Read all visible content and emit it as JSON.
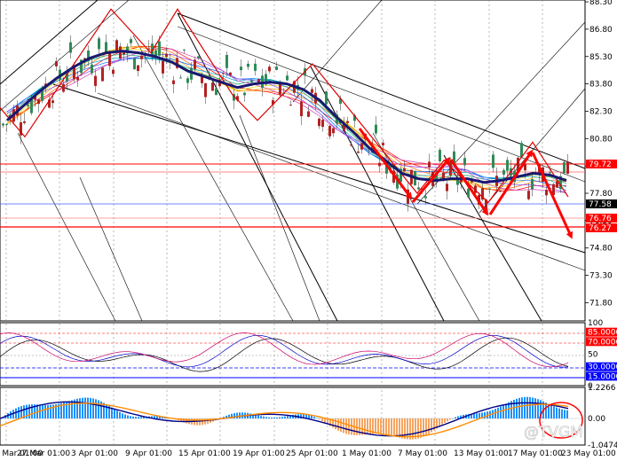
{
  "chart_data": {
    "type": "line",
    "title": "",
    "price_axis": {
      "ticks": [
        "88.30",
        "86.80",
        "85.30",
        "83.80",
        "82.30",
        "80.80",
        "79.30",
        "77.80",
        "76.30",
        "74.80",
        "73.30",
        "71.80"
      ],
      "range": [
        70.8,
        88.4
      ]
    },
    "level_labels": [
      "79.72",
      "77.58",
      "76.76",
      "76.27"
    ],
    "oscillator1": {
      "ticks": [
        "100",
        "85.0000",
        "70.0000",
        "50",
        "30.0000",
        "15.0000",
        "0"
      ],
      "range": [
        0,
        100
      ]
    },
    "oscillator2": {
      "ticks": [
        "1.2266",
        "0.00",
        "-1.0474"
      ],
      "range": [
        -1.0474,
        1.2266
      ]
    },
    "time_axis": [
      "20 Mar 01:00",
      "27 Mar 01:00",
      "3 Apr 01:00",
      "9 Apr 01:00",
      "15 Apr 01:00",
      "19 Apr 01:00",
      "25 Apr 01:00",
      "1 May 01:00",
      "7 May 01:00",
      "13 May 01:00",
      "17 May 01:00",
      "23 May 01:00"
    ],
    "moving_average": [
      81.8,
      82.6,
      83.4,
      84.1,
      84.7,
      85.2,
      85.5,
      85.6,
      85.5,
      85.3,
      85.0,
      84.5,
      84.2,
      83.9,
      83.6,
      83.8,
      83.9,
      83.8,
      83.5,
      82.9,
      82.0,
      81.2,
      80.3,
      79.6,
      78.9,
      78.6,
      78.5,
      78.6,
      78.6,
      78.4,
      78.5,
      78.7,
      78.9,
      78.8,
      78.5
    ],
    "watermark": "@TVGM",
    "colors": {
      "level_lines": "#ff0000",
      "current_price": "#0000ff",
      "moving_average": "#191970",
      "arrows": "#ff0000",
      "histogram_positive": "#1e90ff",
      "histogram_negative": "#f4a460",
      "signal_line": "#ff8c00"
    }
  }
}
